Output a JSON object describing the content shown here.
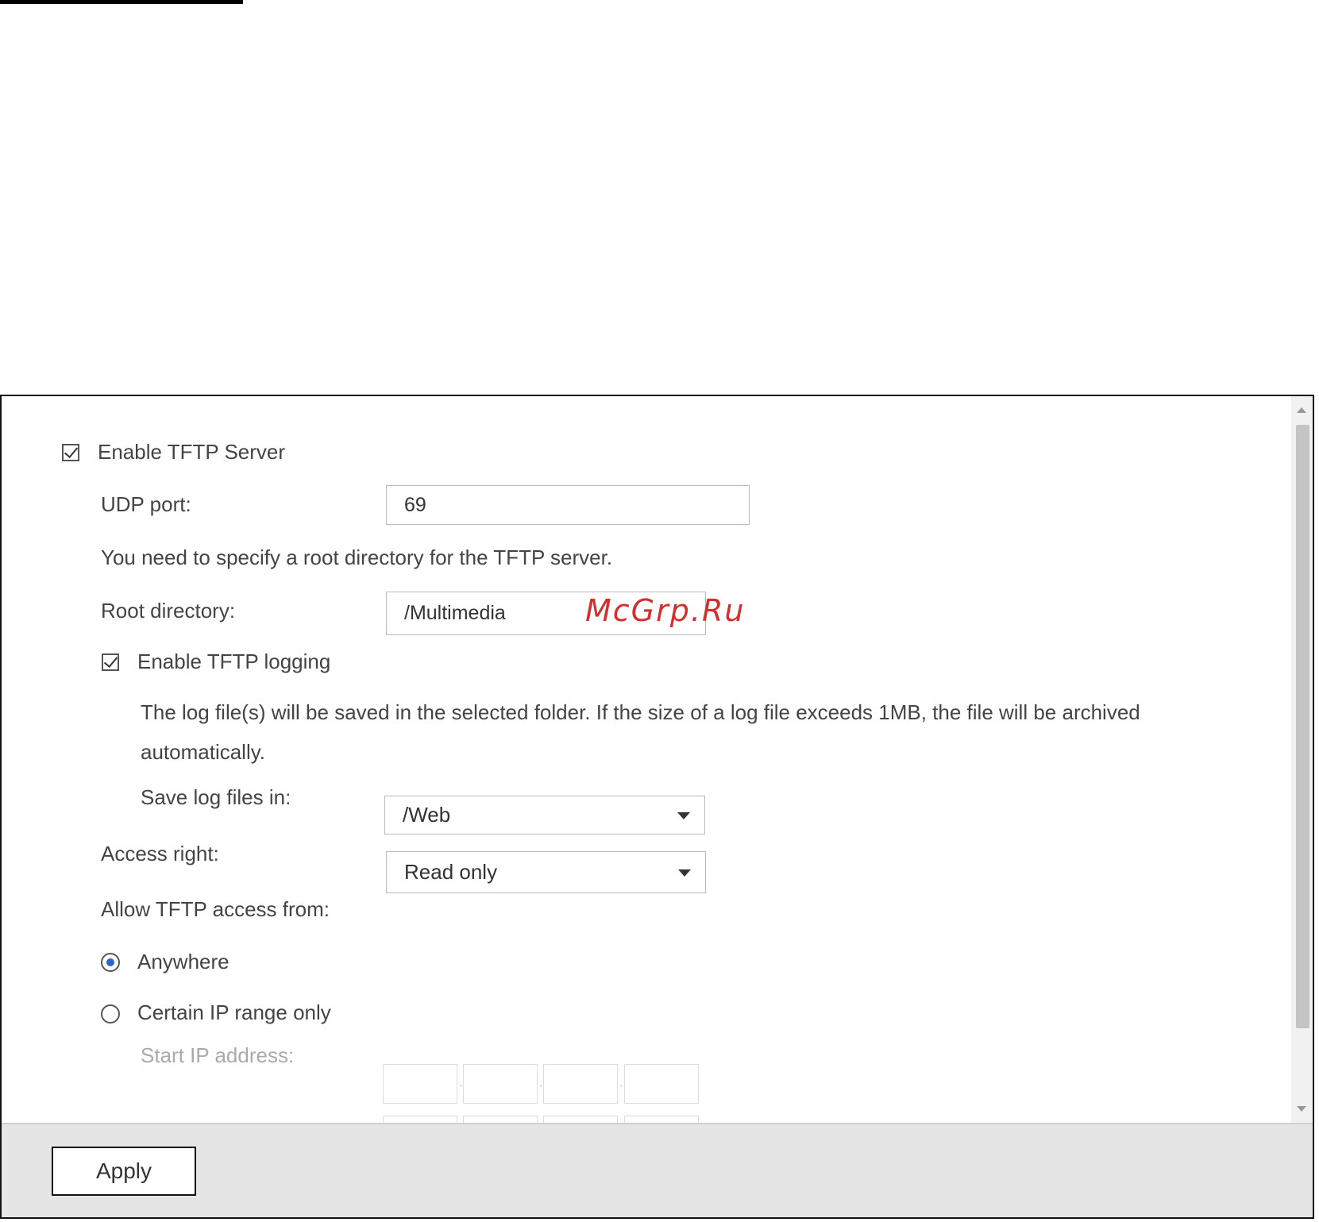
{
  "tftp": {
    "enable_server_label": "Enable TFTP Server",
    "udp_port_label": "UDP port:",
    "udp_port_value": "69",
    "root_note": "You need to specify a root directory for the TFTP server.",
    "root_directory_label": "Root directory:",
    "root_directory_value": "/Multimedia",
    "enable_logging_label": "Enable TFTP logging",
    "log_note_line1": "The log file(s) will be saved in the selected folder. If the size of a log file exceeds 1MB, the file will be archived",
    "log_note_line2": "automatically.",
    "save_log_label": "Save log files in:",
    "save_log_value": "/Web",
    "access_right_label": "Access right:",
    "access_right_value": "Read only",
    "allow_access_label": "Allow TFTP access from:",
    "option_anywhere": "Anywhere",
    "option_ip_range": "Certain IP range only",
    "start_ip_label": "Start IP address:"
  },
  "watermark": "McGrp.Ru",
  "footer": {
    "apply_label": "Apply"
  },
  "colors": {
    "radio_selected": "#2b66c9",
    "watermark": "#d32f2f",
    "footer_bg": "#e5e5e5"
  }
}
